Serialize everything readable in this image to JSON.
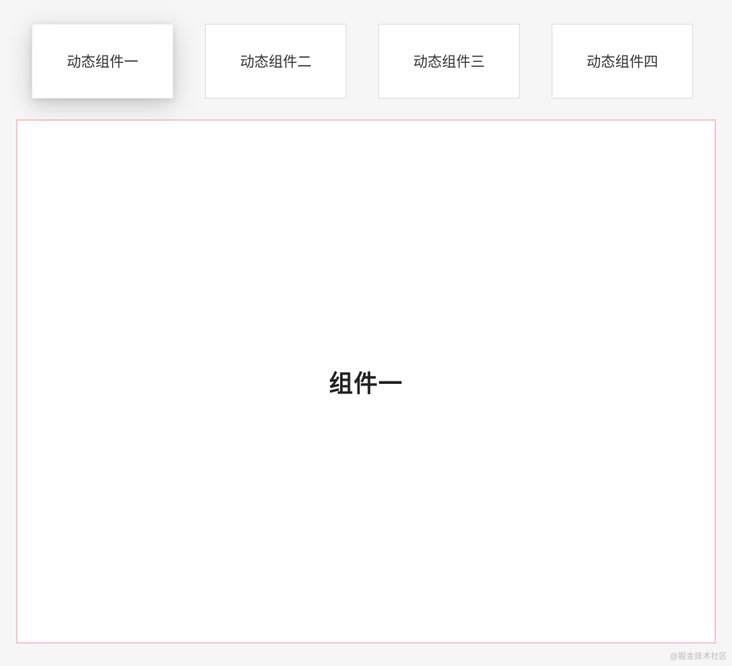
{
  "tabs": [
    {
      "label": "动态组件一",
      "active": true
    },
    {
      "label": "动态组件二",
      "active": false
    },
    {
      "label": "动态组件三",
      "active": false
    },
    {
      "label": "动态组件四",
      "active": false
    }
  ],
  "content": {
    "title": "组件一"
  },
  "watermark": "@掘金技术社区",
  "colors": {
    "panel_border": "#f8c9d0",
    "page_bg": "#f6f6f6",
    "tab_bg": "#ffffff"
  }
}
